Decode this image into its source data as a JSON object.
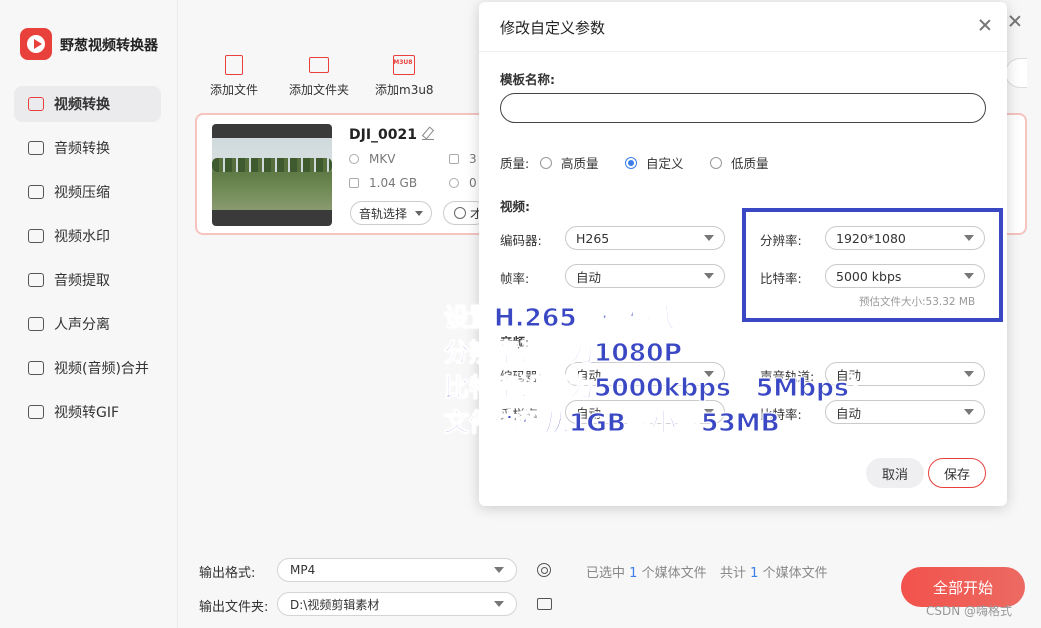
{
  "app": {
    "title": "野葱视频转换器"
  },
  "sidebar": {
    "items": [
      {
        "label": "视频转换",
        "icon": "video-convert-icon",
        "active": true
      },
      {
        "label": "音频转换",
        "icon": "audio-convert-icon"
      },
      {
        "label": "视频压缩",
        "icon": "video-compress-icon"
      },
      {
        "label": "视频水印",
        "icon": "watermark-icon"
      },
      {
        "label": "音频提取",
        "icon": "audio-extract-icon"
      },
      {
        "label": "人声分离",
        "icon": "vocal-separate-icon"
      },
      {
        "label": "视频(音频)合并",
        "icon": "merge-icon"
      },
      {
        "label": "视频转GIF",
        "icon": "gif-icon"
      }
    ]
  },
  "toolbar": {
    "add_file": "添加文件",
    "add_folder": "添加文件夹",
    "add_m3u8": "添加m3u8",
    "m3u8_badge": "M3U8"
  },
  "file": {
    "name": "DJI_0021",
    "format": "MKV",
    "size": "1.04 GB",
    "resolution_partial": "3",
    "duration_partial": "0",
    "audio_track_label": "音轨选择",
    "subtitle_partial": "才"
  },
  "bottom": {
    "output_format_label": "输出格式:",
    "output_format_value": "MP4",
    "output_folder_label": "输出文件夹:",
    "output_folder_value": "D:\\视频剪辑素材",
    "selected_prefix": "已选中",
    "selected_count": "1",
    "selected_suffix": "个媒体文件",
    "total_prefix": "共计",
    "total_count": "1",
    "total_suffix": "个媒体文件",
    "start_label": "全部开始"
  },
  "dialog": {
    "title": "修改自定义参数",
    "template_name_label": "模板名称:",
    "template_name_value": "",
    "quality_label": "质量:",
    "quality_options": [
      "高质量",
      "自定义",
      "低质量"
    ],
    "quality_selected": "自定义",
    "video_section": "视频:",
    "encoder_label": "编码器:",
    "encoder_value": "H265",
    "framerate_label": "帧率:",
    "framerate_value": "自动",
    "resolution_label": "分辨率:",
    "resolution_value": "1920*1080",
    "bitrate_label": "比特率:",
    "bitrate_value": "5000 kbps",
    "estimate": "预估文件大小:53.32 MB",
    "audio_section": "音频:",
    "audio_encoder_label": "编码器:",
    "audio_encoder_value": "自动",
    "samplerate_label": "采样率:",
    "samplerate_value": "自动",
    "channel_label": "声音轨道:",
    "channel_value": "自动",
    "audio_bitrate_label": "比特率:",
    "audio_bitrate_value": "自动",
    "cancel_label": "取消",
    "save_label": "保存"
  },
  "annotation": {
    "lines": [
      "设置H.265编码格式",
      "分辨率调整为1080P",
      "比特率设置为5000kbps（5Mbps）",
      "文件体积从1GB缩小到53MB"
    ],
    "color": "#3a48c4"
  },
  "watermark": "CSDN @嗨格式"
}
